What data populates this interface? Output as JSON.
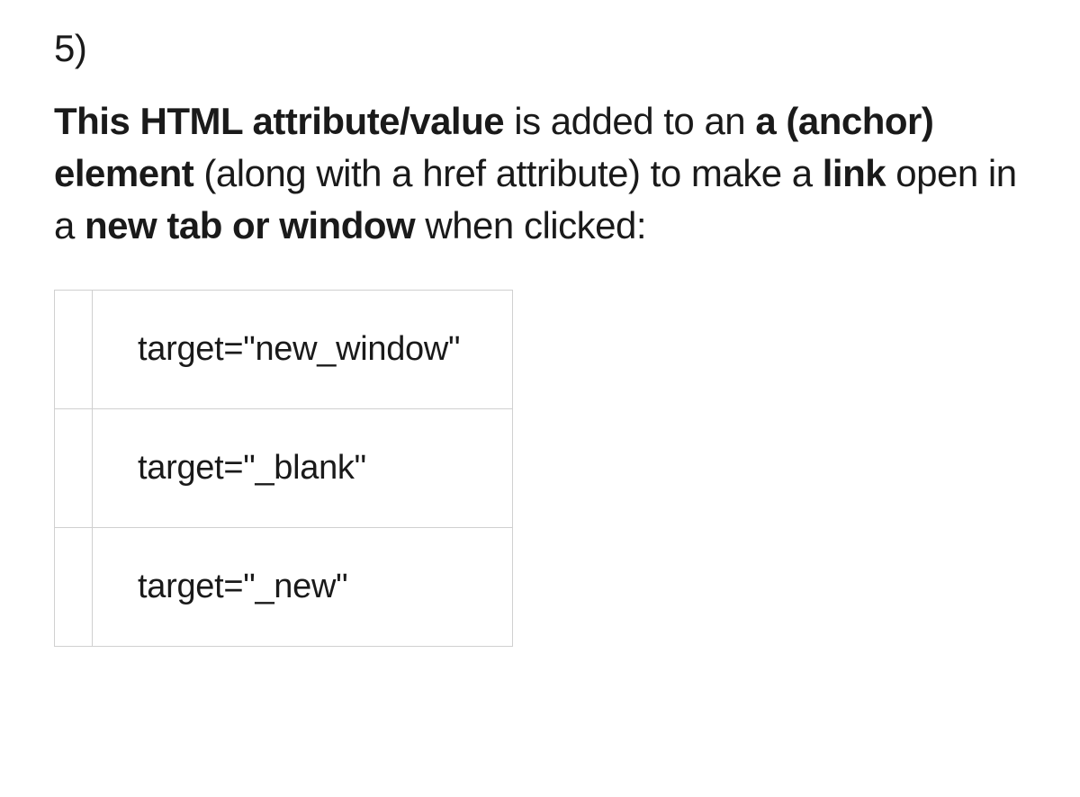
{
  "question": {
    "number": "5)",
    "prompt_segments": [
      {
        "text": "This HTML attribute/value",
        "bold": true
      },
      {
        "text": " is added to an ",
        "bold": false
      },
      {
        "text": "a (anchor) element",
        "bold": true
      },
      {
        "text": " (along with a href attribute) to make a ",
        "bold": false
      },
      {
        "text": "link",
        "bold": true
      },
      {
        "text": " open in a ",
        "bold": false
      },
      {
        "text": "new tab or window",
        "bold": true
      },
      {
        "text": " when clicked:",
        "bold": false
      }
    ],
    "options": [
      "target=\"new_window\"",
      "target=\"_blank\"",
      "target=\"_new\""
    ]
  }
}
